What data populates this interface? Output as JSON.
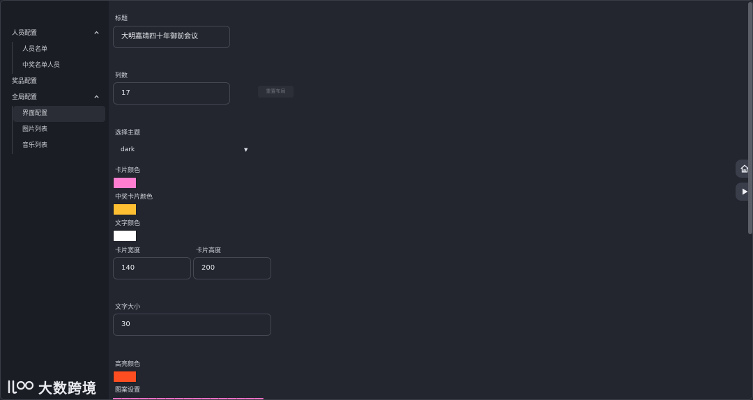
{
  "sidebar": {
    "groups": [
      {
        "label": "人员配置",
        "items": [
          "人员名单",
          "中奖名单人员"
        ]
      },
      {
        "label": "奖品配置",
        "items": []
      },
      {
        "label": "全局配置",
        "items": [
          "界面配置",
          "图片列表",
          "音乐列表"
        ]
      }
    ],
    "active": "界面配置"
  },
  "form": {
    "title_label": "标题",
    "title_value": "大明嘉靖四十年御前会议",
    "columns_label": "列数",
    "columns_value": "17",
    "reset_layout_label": "重置布局",
    "theme_label": "选择主题",
    "theme_value": "dark",
    "card_color_label": "卡片颜色",
    "card_color": "#ff7ed1",
    "winning_card_color_label": "中奖卡片颜色",
    "winning_card_color": "#ffbf33",
    "text_color_label": "文字颜色",
    "text_color": "#ffffff",
    "card_width_label": "卡片宽度",
    "card_width_value": "140",
    "card_height_label": "卡片高度",
    "card_height_value": "200",
    "font_size_label": "文字大小",
    "font_size_value": "30",
    "highlight_color_label": "高亮颜色",
    "highlight_color": "#ff4d22",
    "pattern_label": "图案设置",
    "pattern_color": "#ff6fc0"
  },
  "watermark": {
    "text": "大数跨境"
  },
  "icons": {
    "home": "home-icon",
    "play": "play-icon",
    "chevron": "chevron-up-icon"
  }
}
